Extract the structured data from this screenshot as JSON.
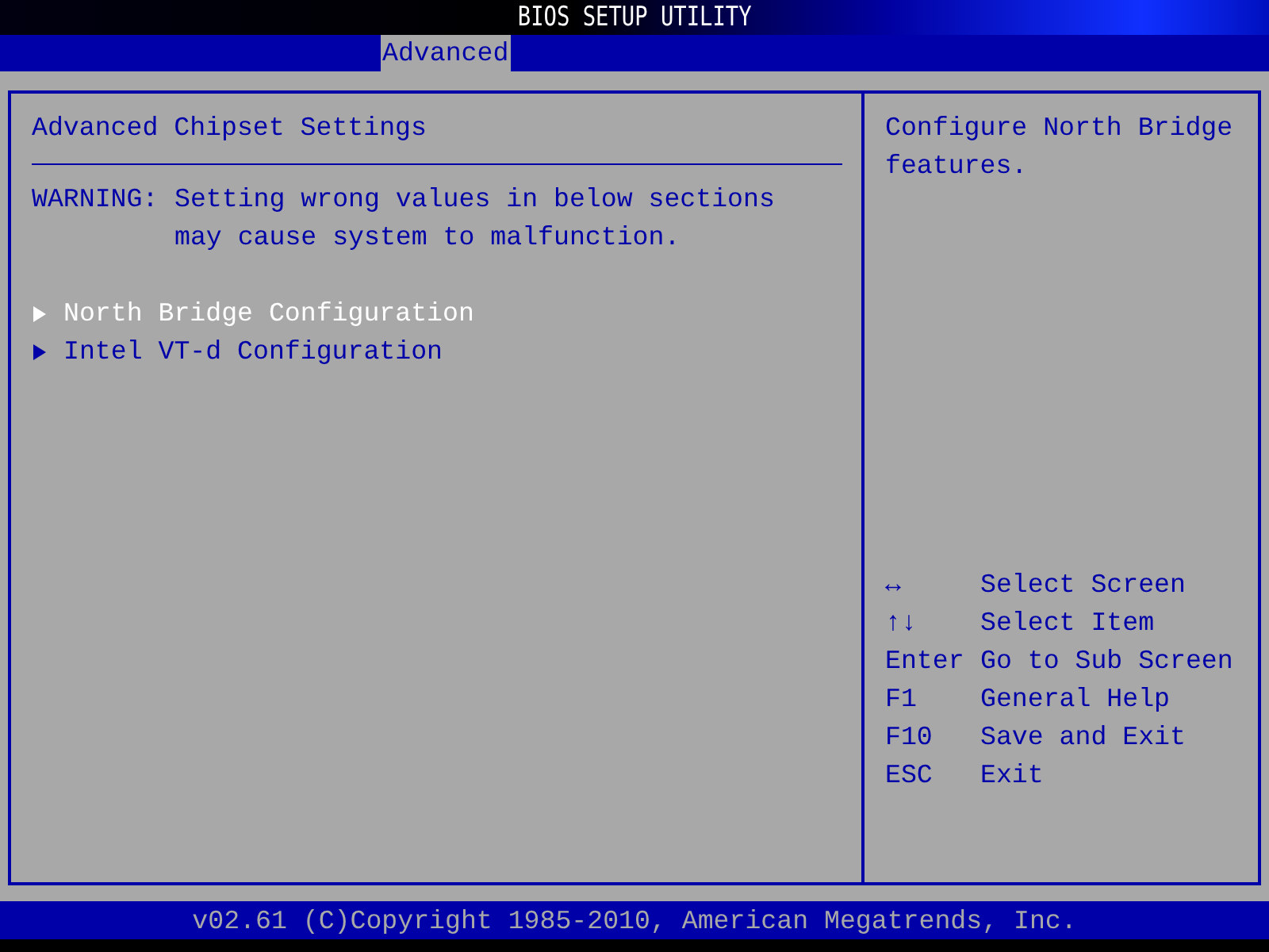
{
  "window": {
    "title": "BIOS SETUP UTILITY"
  },
  "tabs": [
    {
      "label": "Advanced",
      "selected": true
    }
  ],
  "main": {
    "heading": "Advanced Chipset Settings",
    "warning_label": "WARNING:",
    "warning_lines": [
      "Setting wrong values in below sections",
      "may cause system to malfunction."
    ],
    "items": [
      {
        "label": "North Bridge Configuration",
        "selected": true
      },
      {
        "label": "Intel VT-d Configuration",
        "selected": false
      }
    ]
  },
  "help": {
    "text": "Configure North Bridge features.",
    "keys": [
      {
        "key": "↔",
        "action": "Select Screen"
      },
      {
        "key": "↑↓",
        "action": "Select Item"
      },
      {
        "key": "Enter",
        "action": "Go to Sub Screen"
      },
      {
        "key": "F1",
        "action": "General Help"
      },
      {
        "key": "F10",
        "action": "Save and Exit"
      },
      {
        "key": "ESC",
        "action": "Exit"
      }
    ]
  },
  "status_bar": "v02.61 (C)Copyright 1985-2010, American Megatrends, Inc."
}
